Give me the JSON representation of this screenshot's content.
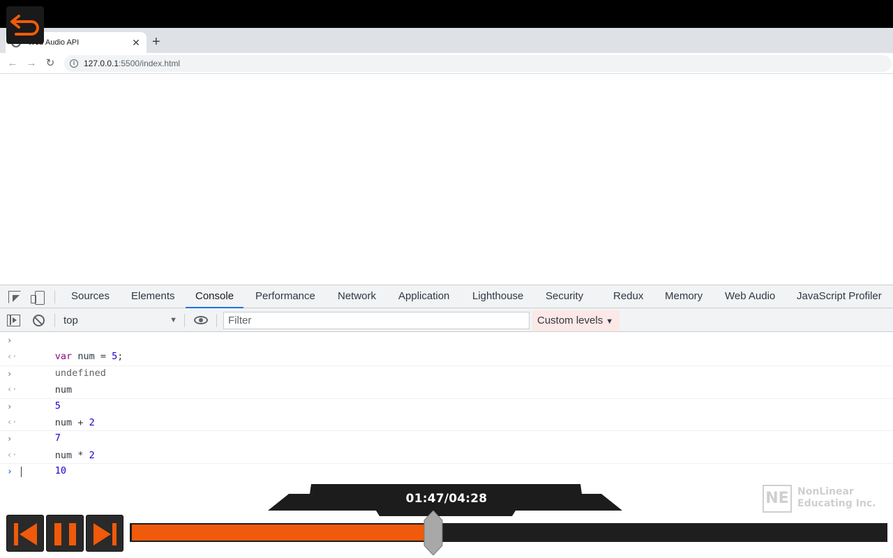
{
  "browser": {
    "tab_title": "Web Audio API",
    "tab_close": "✕",
    "new_tab": "+",
    "url_host": "127.0.0.1",
    "url_rest": ":5500/index.html",
    "back": "←",
    "forward": "→",
    "reload": "↻",
    "info": "i"
  },
  "devtools": {
    "tabs": [
      {
        "label": "Sources"
      },
      {
        "label": "Elements"
      },
      {
        "label": "Console",
        "active": true
      },
      {
        "label": "Performance"
      },
      {
        "label": "Network"
      },
      {
        "label": "Application"
      },
      {
        "label": "Lighthouse"
      },
      {
        "label": "Security"
      },
      {
        "label": "Redux"
      },
      {
        "label": "Memory"
      },
      {
        "label": "Web Audio"
      },
      {
        "label": "JavaScript Profiler"
      }
    ],
    "context": "top",
    "filter_placeholder": "Filter",
    "levels_label": "Custom levels",
    "caret": "▼"
  },
  "console": {
    "prompt_in": "›",
    "prompt_out": "‹·",
    "entries": [
      {
        "input": {
          "kw": "var",
          "name": "num",
          "eq": "=",
          "val": "5",
          "end": ";"
        },
        "output": "undefined"
      },
      {
        "input": {
          "text": "num"
        },
        "output": "5"
      },
      {
        "input": {
          "name": "num",
          "op": "+",
          "val": "2"
        },
        "output": "7"
      },
      {
        "input": {
          "name": "num",
          "op": "*",
          "val": "2"
        },
        "output": "10"
      }
    ]
  },
  "player": {
    "time": "01:47/04:28",
    "progress": 0.4,
    "logo_mark": "NE",
    "logo_line1": "NonLinear",
    "logo_line2": "Educating Inc.",
    "colors": {
      "accent": "#f05a0a",
      "track": "#1e1e1e",
      "button": "#2a2a2a"
    }
  }
}
